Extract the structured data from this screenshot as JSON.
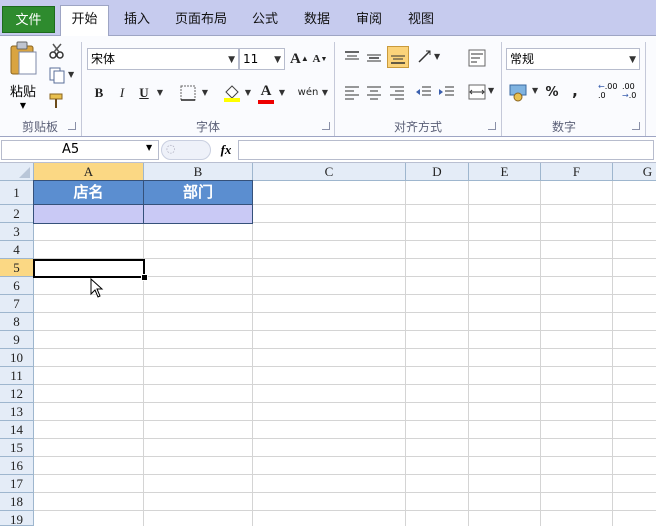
{
  "tabs": {
    "file": "文件",
    "home": "开始",
    "insert": "插入",
    "page_layout": "页面布局",
    "formulas": "公式",
    "data": "数据",
    "review": "审阅",
    "view": "视图"
  },
  "ribbon": {
    "clipboard": {
      "label": "剪贴板",
      "paste": "粘贴"
    },
    "font": {
      "label": "字体",
      "font_name": "宋体",
      "font_size": "11",
      "bold": "B",
      "italic": "I",
      "underline": "U",
      "grow": "A",
      "shrink": "A",
      "font_color": "A",
      "phonetic": "wén"
    },
    "alignment": {
      "label": "对齐方式"
    },
    "number": {
      "label": "数字",
      "format": "常规",
      "percent": "%",
      "comma": ",",
      "inc_decimal": ".00",
      "dec_decimal": ".00"
    }
  },
  "formula_bar": {
    "name_box": "A5",
    "fx": "fx",
    "formula": ""
  },
  "sheet": {
    "columns": [
      "A",
      "B",
      "C",
      "D",
      "E",
      "F",
      "G"
    ],
    "rows": [
      "1",
      "2",
      "3",
      "4",
      "5",
      "6",
      "7",
      "8",
      "9",
      "10",
      "11",
      "12",
      "13",
      "14",
      "15",
      "16",
      "17",
      "18",
      "19"
    ],
    "cells": {
      "A1": "店名",
      "B1": "部门"
    },
    "selected_cell": "A5"
  },
  "colors": {
    "header_fill": "#5b8ed0",
    "row2_fill": "#c9c9f5",
    "selection_header": "#fbd884",
    "file_tab": "#2e8b2e"
  }
}
